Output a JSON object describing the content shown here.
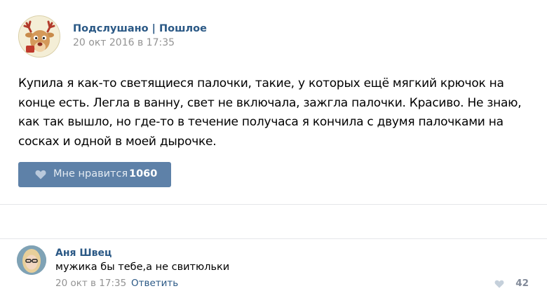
{
  "post": {
    "group_name": "Подслушано | Пошлое",
    "date": "20 окт 2016 в 17:35",
    "avatar_icon": "deer-mascot-icon",
    "text": "Купила я как-то светящиеся палочки, такие, у которых ещё мягкий крючок на конце есть. Легла в ванну, свет не включала, зажгла палочки. Красиво. Не знаю, как так вышло, но где-то в течение получаса я кончила с двумя палочками на сосках и одной в моей дырочке.",
    "like_label": "Мне нравится",
    "like_count": "1060",
    "like_icon": "heart-icon"
  },
  "comment": {
    "author": "Аня Швец",
    "text": "мужика бы тебе,а не свитюльки",
    "date": "20 окт в 17:35",
    "reply_label": "Ответить",
    "like_count": "42",
    "like_icon": "heart-icon"
  },
  "colors": {
    "link": "#2a5885",
    "meta": "#939393",
    "like_button": "#5e81a8",
    "divider": "#e4e6e9"
  }
}
